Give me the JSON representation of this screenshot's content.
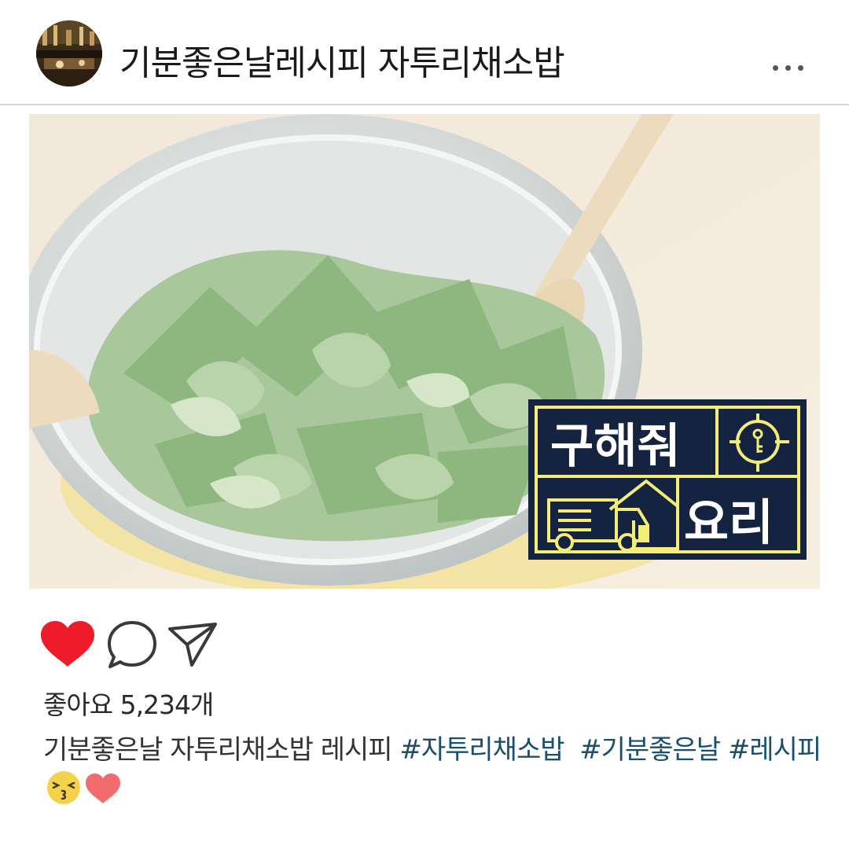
{
  "post": {
    "username": "기분좋은날레시피 자투리채소밥",
    "likes_text": "좋아요 5,234개",
    "caption": {
      "text": "기분좋은날 자투리채소밥 레시피",
      "hashtags": [
        "#자투리채소밥",
        "#기분좋은날",
        "#레시피"
      ]
    }
  },
  "photo": {
    "logo": {
      "line1": "구해줘",
      "line2": "요리"
    }
  },
  "colors": {
    "like_red": "#ee1c2a",
    "hashtag": "#1a4f6e",
    "logo_navy": "#142440",
    "logo_yellow": "#f4ec78",
    "heart_emoji": "#f16b6f",
    "face_emoji": "#f5d24c"
  },
  "icons": [
    "more-options-icon",
    "heart-icon",
    "comment-icon",
    "share-icon",
    "kissing-face-emoji",
    "heart-emoji"
  ]
}
